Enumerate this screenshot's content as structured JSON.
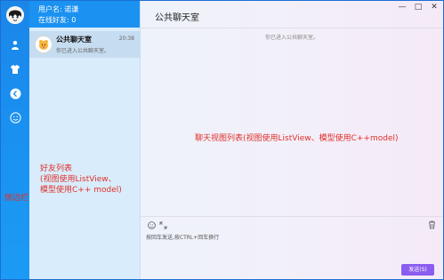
{
  "rail": {
    "icons": [
      "avatar-icon",
      "user-icon",
      "shirt-icon",
      "back-arrow-icon",
      "emoji-icon"
    ],
    "note": "侧边栏"
  },
  "user": {
    "name_line": "用户名: 诺谦",
    "online_line": "在线好友: 0"
  },
  "friends": [
    {
      "name": "公共聊天室",
      "time": "20:38",
      "preview": "你已进入公共聊天室。"
    }
  ],
  "friends_note": {
    "line1": "好友列表",
    "line2": "(视图使用ListView、",
    "line3": "模型使用C++ model)"
  },
  "chat": {
    "title": "公共聊天室",
    "system_message": "你已进入公共聊天室。",
    "note": "聊天视图列表(视图使用ListView、模型使用C++model)",
    "hint": "按回车发送,按CTRL+回车换行",
    "send_label": "发送(S)"
  },
  "window_controls": {
    "minimize": "—",
    "maximize": "□",
    "close": "✕"
  },
  "colors": {
    "rail": "#1a8ff0",
    "user_header": "#1b91f1",
    "friends_bg": "#d9ecfb",
    "selected_item": "#c6dcf0",
    "annotation": "#e0302a",
    "send_button": "#8a5cf0"
  }
}
